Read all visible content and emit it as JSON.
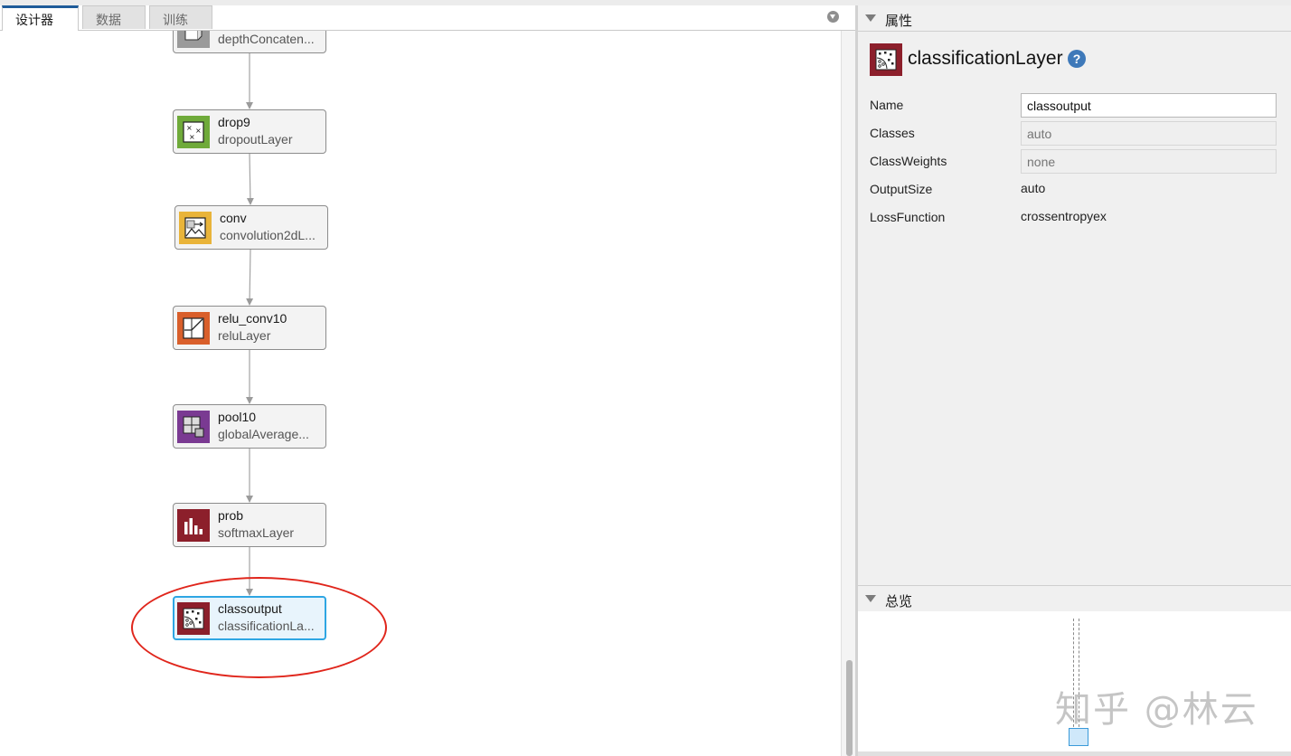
{
  "tabs": [
    {
      "label": "设计器",
      "active": true
    },
    {
      "label": "数据",
      "active": false
    },
    {
      "label": "训练",
      "active": false
    }
  ],
  "nodes": [
    {
      "name": "",
      "type": "depthConcatenationLayer",
      "type_display": "depthConcaten...",
      "color": "#9a9a9a",
      "icon": "depth-concat-icon"
    },
    {
      "name": "drop9",
      "type": "dropoutLayer",
      "type_display": "dropoutLayer",
      "color": "#6faa3a",
      "icon": "dropout-icon"
    },
    {
      "name": "conv",
      "type": "convolution2dLayer",
      "type_display": "convolution2dL...",
      "color": "#e9b43a",
      "icon": "convolution-icon"
    },
    {
      "name": "relu_conv10",
      "type": "reluLayer",
      "type_display": "reluLayer",
      "color": "#d95f2b",
      "icon": "relu-icon"
    },
    {
      "name": "pool10",
      "type": "globalAveragePooling2dLayer",
      "type_display": "globalAverage...",
      "color": "#7a3a92",
      "icon": "pooling-icon"
    },
    {
      "name": "prob",
      "type": "softmaxLayer",
      "type_display": "softmaxLayer",
      "color": "#8c1f2b",
      "icon": "softmax-icon"
    },
    {
      "name": "classoutput",
      "type": "classificationLayer",
      "type_display": "classificationLa...",
      "color": "#8c1f2b",
      "icon": "classification-icon",
      "selected": true
    }
  ],
  "properties": {
    "header": "属性",
    "layer_title": "classificationLayer",
    "help_label": "?",
    "fields": {
      "name": {
        "label": "Name",
        "value": "classoutput"
      },
      "classes": {
        "label": "Classes",
        "placeholder": "auto"
      },
      "class_weights": {
        "label": "ClassWeights",
        "placeholder": "none"
      },
      "output_size": {
        "label": "OutputSize",
        "value": "auto"
      },
      "loss_function": {
        "label": "LossFunction",
        "value": "crossentropyex"
      }
    }
  },
  "overview": {
    "header": "总览"
  },
  "watermark": "知乎 @林云",
  "colors": {
    "accent_tab": "#1f5c99",
    "selection": "#2ea6e3",
    "annotation": "#e0261c"
  }
}
